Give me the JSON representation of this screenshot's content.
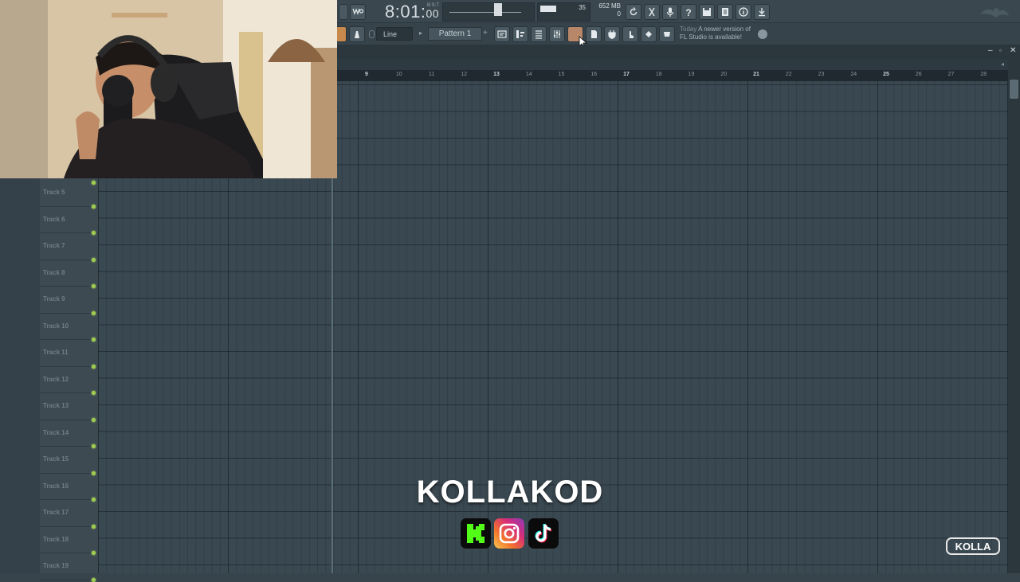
{
  "toolbar": {
    "time_main": "8:01:",
    "time_small": "00",
    "time_mode": "B:S:T",
    "cpu_value": "35",
    "ram_value": "652 MB",
    "ram_polyphony": "0",
    "snap_mode": "Line",
    "pattern_name": "Pattern 1",
    "news_today": "Today",
    "news_text": "A newer version of FL Studio is available!"
  },
  "ruler": {
    "bars": [
      {
        "num": "9",
        "major": true
      },
      {
        "num": "10",
        "major": false
      },
      {
        "num": "11",
        "major": false
      },
      {
        "num": "12",
        "major": false
      },
      {
        "num": "13",
        "major": true
      },
      {
        "num": "14",
        "major": false
      },
      {
        "num": "15",
        "major": false
      },
      {
        "num": "16",
        "major": false
      },
      {
        "num": "17",
        "major": true
      },
      {
        "num": "18",
        "major": false
      },
      {
        "num": "19",
        "major": false
      },
      {
        "num": "20",
        "major": false
      },
      {
        "num": "21",
        "major": true
      },
      {
        "num": "22",
        "major": false
      },
      {
        "num": "23",
        "major": false
      },
      {
        "num": "24",
        "major": false
      },
      {
        "num": "25",
        "major": true
      },
      {
        "num": "26",
        "major": false
      },
      {
        "num": "27",
        "major": false
      },
      {
        "num": "28",
        "major": false
      }
    ]
  },
  "tracks": [
    "Track 5",
    "Track 6",
    "Track 7",
    "Track 8",
    "Track 9",
    "Track 10",
    "Track 11",
    "Track 12",
    "Track 13",
    "Track 14",
    "Track 15",
    "Track 16",
    "Track 17",
    "Track 18",
    "Track 19"
  ],
  "overlay": {
    "brand": "KOLLAKOD",
    "logo_text": "KOLLA",
    "social_icons": [
      "kick-icon",
      "instagram-icon",
      "tiktok-icon"
    ]
  },
  "colors": {
    "playlist_bg": "#3a4851",
    "track_led": "#9fcf4e",
    "brand_text": "#ffffff"
  }
}
